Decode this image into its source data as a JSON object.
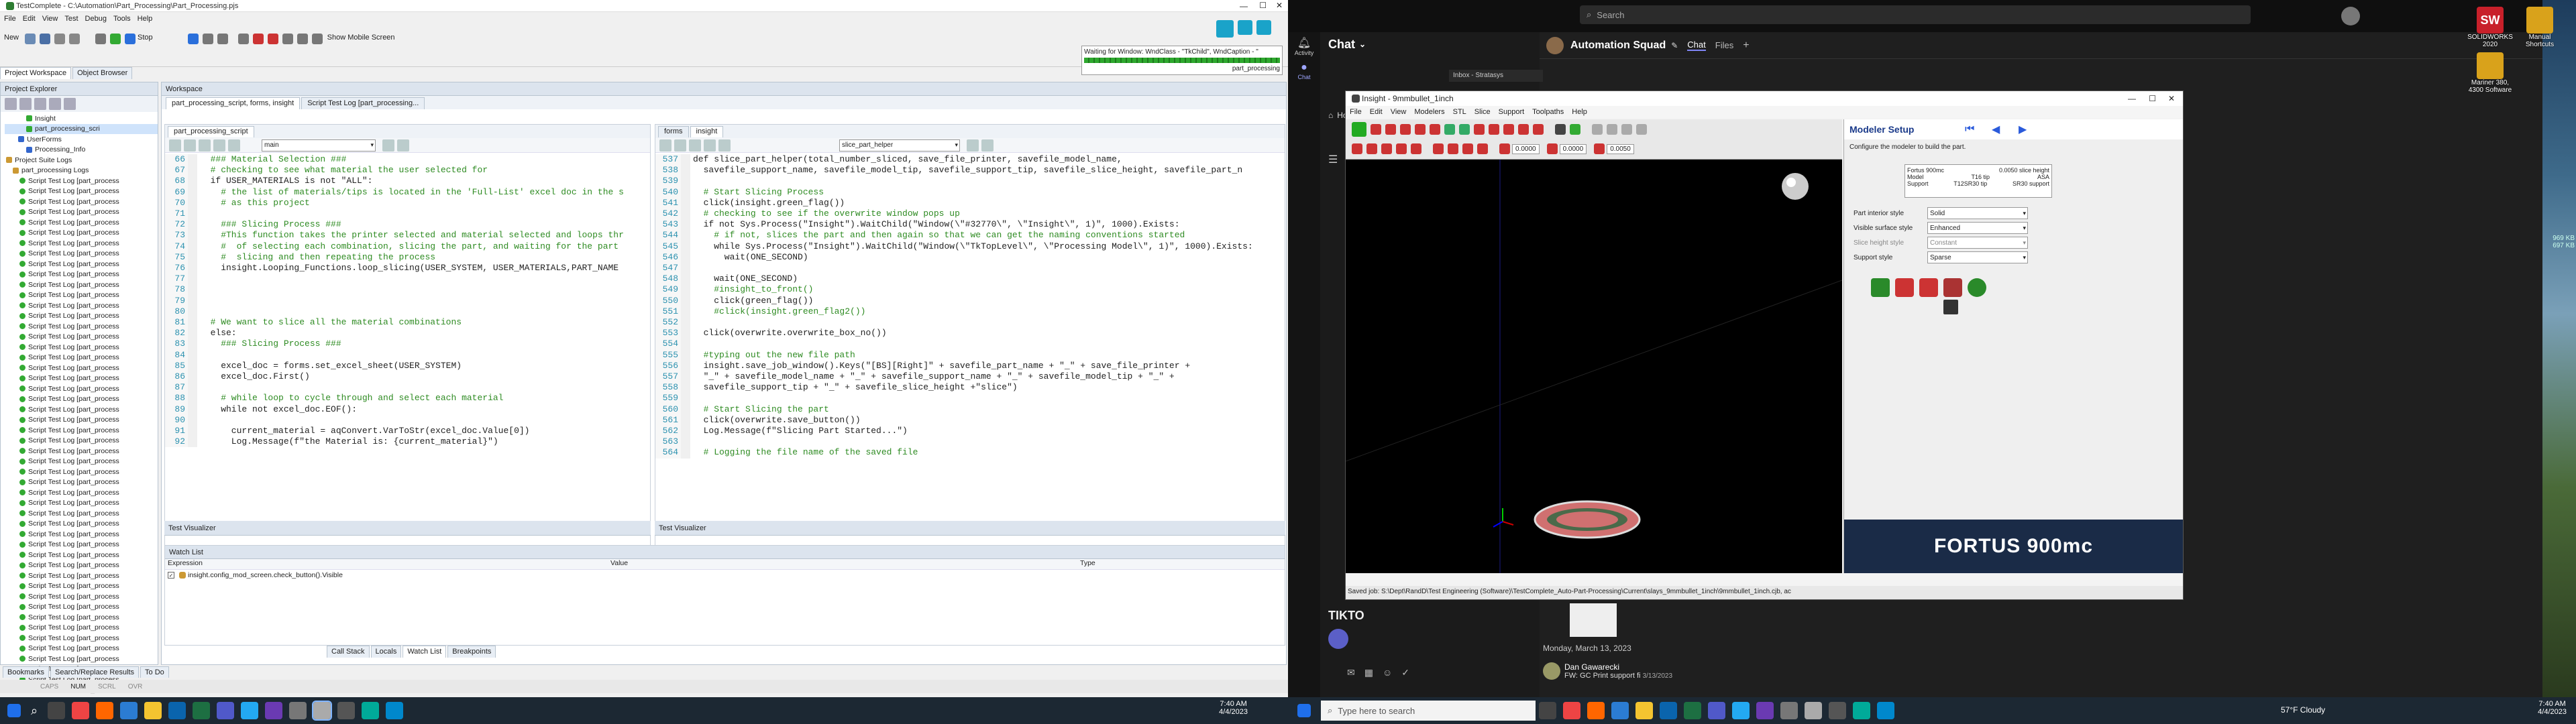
{
  "left": {
    "title": "TestComplete - C:\\Automation\\Part_Processing\\Part_Processing.pjs",
    "menus": [
      "File",
      "Edit",
      "View",
      "Test",
      "Debug",
      "Tools",
      "Help"
    ],
    "toolbar": {
      "new": "New",
      "stop": "Stop",
      "mobile": "Show Mobile Screen"
    },
    "waiting": {
      "text": "Waiting for Window: WndClass - \"TkChild\", WndCaption - \"",
      "process": "part_processing"
    },
    "tabs_left": [
      "Project Workspace",
      "Object Browser"
    ],
    "explorer_title": "Project Explorer",
    "tree": [
      {
        "label": "Insight",
        "indent": 32,
        "color": "#3a3",
        "sel": false
      },
      {
        "label": "part_processing_scri",
        "indent": 32,
        "color": "#3a3",
        "sel": true
      },
      {
        "label": "UserForms",
        "indent": 20,
        "color": "#36c",
        "sel": false
      },
      {
        "label": "Processing_Info",
        "indent": 32,
        "color": "#36c",
        "sel": false
      },
      {
        "label": "Project Suite Logs",
        "indent": 2,
        "color": "#c93",
        "sel": false
      },
      {
        "label": "part_processing Logs",
        "indent": 12,
        "color": "#c93",
        "sel": false
      }
    ],
    "log_item": "Script Test Log [part_process",
    "workspace_title": "Workspace",
    "ws_tabs": [
      "part_processing_script, forms, insight",
      "Script Test Log [part_processing..."
    ],
    "editor1": {
      "tab": "part_processing_script",
      "dropdown": "main",
      "lines": [
        {
          "n": "66",
          "t": "  ### Material Selection ###",
          "c": "cm"
        },
        {
          "n": "67",
          "t": "  # checking to see what material the user selected for",
          "c": "cm"
        },
        {
          "n": "68",
          "t": "  if USER_MATERIALS is not \"ALL\":",
          "c": ""
        },
        {
          "n": "69",
          "t": "    # the list of materials/tips is located in the 'Full-List' excel doc in the s",
          "c": "cm"
        },
        {
          "n": "70",
          "t": "    # as this project",
          "c": "cm"
        },
        {
          "n": "71",
          "t": "",
          "c": ""
        },
        {
          "n": "72",
          "t": "    ### Slicing Process ###",
          "c": "cm"
        },
        {
          "n": "73",
          "t": "    #This function takes the printer selected and material selected and loops thr",
          "c": "cm"
        },
        {
          "n": "74",
          "t": "    #  of selecting each combination, slicing the part, and waiting for the part",
          "c": "cm"
        },
        {
          "n": "75",
          "t": "    #  slicing and then repeating the process",
          "c": "cm"
        },
        {
          "n": "76",
          "t": "    insight.Looping_Functions.loop_slicing(USER_SYSTEM, USER_MATERIALS,PART_NAME",
          "c": ""
        },
        {
          "n": "77",
          "t": "",
          "c": ""
        },
        {
          "n": "78",
          "t": "",
          "c": ""
        },
        {
          "n": "79",
          "t": "",
          "c": ""
        },
        {
          "n": "80",
          "t": "",
          "c": ""
        },
        {
          "n": "81",
          "t": "  # We want to slice all the material combinations",
          "c": "cm"
        },
        {
          "n": "82",
          "t": "  else:",
          "c": ""
        },
        {
          "n": "83",
          "t": "    ### Slicing Process ###",
          "c": "cm"
        },
        {
          "n": "84",
          "t": "",
          "c": ""
        },
        {
          "n": "85",
          "t": "    excel_doc = forms.set_excel_sheet(USER_SYSTEM)",
          "c": ""
        },
        {
          "n": "86",
          "t": "    excel_doc.First()",
          "c": ""
        },
        {
          "n": "87",
          "t": "",
          "c": ""
        },
        {
          "n": "88",
          "t": "    # while loop to cycle through and select each material",
          "c": "cm"
        },
        {
          "n": "89",
          "t": "    while not excel_doc.EOF():",
          "c": ""
        },
        {
          "n": "90",
          "t": "",
          "c": ""
        },
        {
          "n": "91",
          "t": "      current_material = aqConvert.VarToStr(excel_doc.Value[0])",
          "c": ""
        },
        {
          "n": "92",
          "t": "      Log.Message(f\"the Material is: {current_material}\")",
          "c": ""
        }
      ]
    },
    "editor2": {
      "tabs": [
        "forms",
        "insight"
      ],
      "dropdown": "slice_part_helper",
      "lines": [
        {
          "n": "537",
          "t": "def slice_part_helper(total_number_sliced, save_file_printer, savefile_model_name,",
          "c": ""
        },
        {
          "n": "538",
          "t": "  savefile_support_name, savefile_model_tip, savefile_support_tip, savefile_slice_height, savefile_part_n",
          "c": ""
        },
        {
          "n": "539",
          "t": "",
          "c": ""
        },
        {
          "n": "540",
          "t": "  # Start Slicing Process",
          "c": "cm"
        },
        {
          "n": "541",
          "t": "  click(insight.green_flag())",
          "c": ""
        },
        {
          "n": "542",
          "t": "  # checking to see if the overwrite window pops up",
          "c": "cm"
        },
        {
          "n": "543",
          "t": "  if not Sys.Process(\"Insight\").WaitChild(\"Window(\\\"#32770\\\", \\\"Insight\\\", 1)\", 1000).Exists:",
          "c": ""
        },
        {
          "n": "544",
          "t": "    # if not, slices the part and then again so that we can get the naming conventions started",
          "c": "cm"
        },
        {
          "n": "545",
          "t": "    while Sys.Process(\"Insight\").WaitChild(\"Window(\\\"TkTopLevel\\\", \\\"Processing Model\\\", 1)\", 1000).Exists:",
          "c": ""
        },
        {
          "n": "546",
          "t": "      wait(ONE_SECOND)",
          "c": ""
        },
        {
          "n": "547",
          "t": "",
          "c": ""
        },
        {
          "n": "548",
          "t": "    wait(ONE_SECOND)",
          "c": ""
        },
        {
          "n": "549",
          "t": "    #insight_to_front()",
          "c": "cm"
        },
        {
          "n": "550",
          "t": "    click(green_flag())",
          "c": ""
        },
        {
          "n": "551",
          "t": "    #click(insight.green_flag2())",
          "c": "cm"
        },
        {
          "n": "552",
          "t": "",
          "c": ""
        },
        {
          "n": "553",
          "t": "  click(overwrite.overwrite_box_no())",
          "c": ""
        },
        {
          "n": "554",
          "t": "",
          "c": ""
        },
        {
          "n": "555",
          "t": "  #typing out the new file path",
          "c": "cm"
        },
        {
          "n": "556",
          "t": "  insight.save_job_window().Keys(\"[BS][Right]\" + savefile_part_name + \"_\" + save_file_printer +",
          "c": ""
        },
        {
          "n": "557",
          "t": "  \"_\" + savefile_model_name + \"_\" + savefile_support_name + \"_\" + savefile_model_tip + \"_\" +",
          "c": ""
        },
        {
          "n": "558",
          "t": "  savefile_support_tip + \"_\" + savefile_slice_height +\"slice\")",
          "c": ""
        },
        {
          "n": "559",
          "t": "",
          "c": ""
        },
        {
          "n": "560",
          "t": "  # Start Slicing the part",
          "c": "cm"
        },
        {
          "n": "561",
          "t": "  click(overwrite.save_button())",
          "c": ""
        },
        {
          "n": "562",
          "t": "  Log.Message(f\"Slicing Part Started...\")",
          "c": ""
        },
        {
          "n": "563",
          "t": "",
          "c": ""
        },
        {
          "n": "564",
          "t": "  # Logging the file name of the saved file",
          "c": "cm"
        }
      ]
    },
    "test_visualizer": "Test Visualizer",
    "watch": {
      "title": "Watch List",
      "cols": [
        "Expression",
        "Value",
        "Type"
      ],
      "row": "insight.config_mod_screen.check_button().Visible"
    },
    "bottom_tabs": [
      "Call Stack",
      "Locals",
      "Watch List",
      "Breakpoints"
    ],
    "status_tabs": [
      "Bookmarks",
      "Search/Replace Results",
      "To Do"
    ],
    "status_keys": [
      "CAPS",
      "NUM",
      "SCRL",
      "OVR"
    ],
    "clock": {
      "time": "7:40 AM",
      "date": "4/4/2023"
    }
  },
  "right": {
    "search_placeholder": "Search",
    "teams": {
      "title": "Chat",
      "channel": "Automation Squad",
      "tabs": [
        "Chat",
        "Files"
      ],
      "inbox": "Inbox - Stratasys",
      "rail": [
        "Activity",
        "Chat"
      ],
      "home": "Home",
      "date": "Monday, March 13, 2023",
      "person": "Dan Gawarecki",
      "msg": "FW: GC Print support fi",
      "msg_date": "3/13/2023",
      "tiktok": "TIKTO"
    },
    "insight": {
      "title": "Insight - 9mmbullet_1inch",
      "menus": [
        "File",
        "Edit",
        "View",
        "Modelers",
        "STL",
        "Slice",
        "Support",
        "Toolpaths",
        "Help"
      ],
      "val1": "0.0000",
      "val2": "0.0000",
      "val3": "0.0050",
      "status": "Saved job: S:\\Dept\\RandD\\Test Engineering (Software)\\TestComplete_Auto-Part-Processing\\Current\\slays_9mmbullet_1inch\\9mmbullet_1inch.cjb, ac",
      "modeler_title": "Modeler Setup",
      "modeler_desc": "Configure the modeler to build the part.",
      "info": [
        [
          "Fortus 900mc",
          "0.0050 slice height"
        ],
        [
          "Model",
          "T16 tip",
          "ASA"
        ],
        [
          "Support",
          "T12SR30 tip",
          "SR30 support"
        ]
      ],
      "fields": [
        {
          "label": "Part interior style",
          "value": "Solid"
        },
        {
          "label": "Visible surface style",
          "value": "Enhanced"
        },
        {
          "label": "Slice height style",
          "value": "Constant"
        },
        {
          "label": "Support style",
          "value": "Sparse"
        }
      ],
      "brand": "FORTUS 900mc"
    },
    "desktop_icons": [
      {
        "name": "SOLIDWORKS 2020",
        "color": "#c8202a",
        "text": "SW"
      },
      {
        "name": "Manual Shortcuts",
        "color": "#d9a21b",
        "text": ""
      },
      {
        "name": "Mariner 380, 4300 Software",
        "color": "#d9a21b",
        "text": ""
      }
    ],
    "side_values": [
      "969 KB",
      "697 KB"
    ],
    "taskbar": {
      "search": "Type here to search",
      "weather": "57°F  Cloudy",
      "time": "7:40 AM",
      "date": "4/4/2023"
    }
  }
}
